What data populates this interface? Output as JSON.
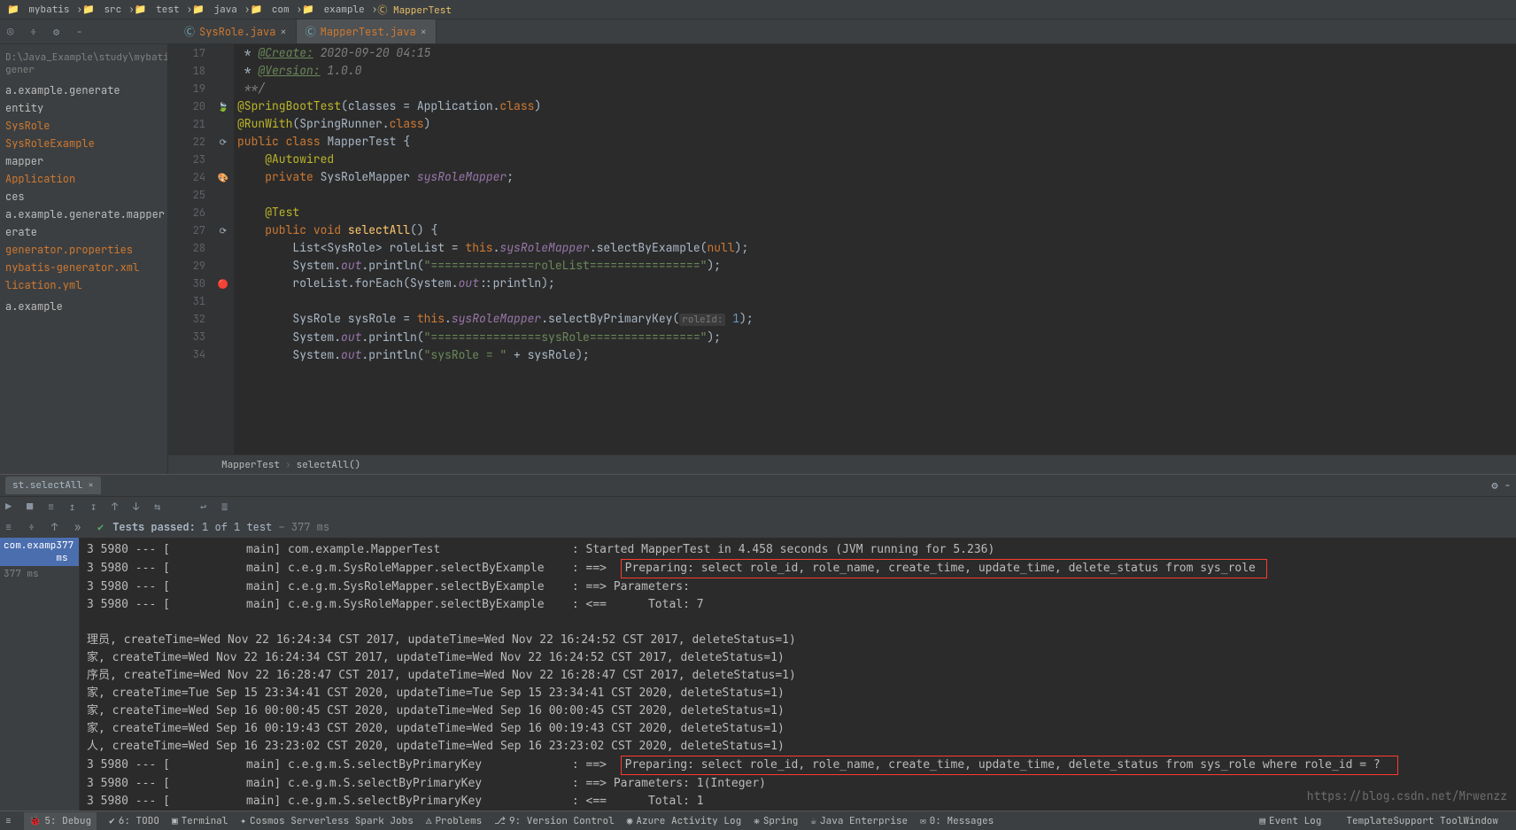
{
  "breadcrumb": [
    "mybatis",
    "src",
    "test",
    "java",
    "com",
    "example",
    "MapperTest"
  ],
  "projectPath": "D:\\Java_Example\\study\\mybatis-gener",
  "tabs": [
    {
      "name": "SysRole.java",
      "active": false
    },
    {
      "name": "MapperTest.java",
      "active": true
    }
  ],
  "tree": [
    {
      "label": "a.example.generate",
      "cls": "normal"
    },
    {
      "label": "entity",
      "cls": "normal"
    },
    {
      "label": "SysRole",
      "cls": "orange"
    },
    {
      "label": "SysRoleExample",
      "cls": "orange"
    },
    {
      "label": "mapper",
      "cls": "normal"
    },
    {
      "label": "Application",
      "cls": "orange"
    },
    {
      "label": "ces",
      "cls": "normal"
    },
    {
      "label": "a.example.generate.mapper",
      "cls": "normal"
    },
    {
      "label": "erate",
      "cls": "normal"
    },
    {
      "label": "generator.properties",
      "cls": "orange"
    },
    {
      "label": "nybatis-generator.xml",
      "cls": "orange"
    },
    {
      "label": "lication.yml",
      "cls": "orange"
    },
    {
      "label": "",
      "cls": "normal"
    },
    {
      "label": "a.example",
      "cls": "normal"
    }
  ],
  "code": {
    "lines": [
      {
        "n": 17,
        "html": "&nbsp;* <span class='doc-tag'>@Create:</span> <span class='comment'>2020-09-20 04:15</span>"
      },
      {
        "n": 18,
        "html": "&nbsp;* <span class='doc-tag'>@Version:</span> <span class='comment'>1.0.0</span>"
      },
      {
        "n": 19,
        "html": "&nbsp;<span class='comment'>**/</span>"
      },
      {
        "n": 20,
        "html": "<span class='anno'>@SpringBootTest</span>(classes = Application.<span class='kw'>class</span>)"
      },
      {
        "n": 21,
        "html": "<span class='anno'>@RunWith</span>(SpringRunner.<span class='kw'>class</span>)"
      },
      {
        "n": 22,
        "html": "<span class='kw'>public</span> <span class='kw'>class</span> MapperTest {"
      },
      {
        "n": 23,
        "html": "&nbsp;&nbsp;&nbsp;&nbsp;<span class='anno'>@Autowired</span>"
      },
      {
        "n": 24,
        "html": "&nbsp;&nbsp;&nbsp;&nbsp;<span class='kw'>private</span> SysRoleMapper <span class='field'>sysRoleMapper</span>;"
      },
      {
        "n": 25,
        "html": ""
      },
      {
        "n": 26,
        "html": "&nbsp;&nbsp;&nbsp;&nbsp;<span class='anno'>@Test</span>"
      },
      {
        "n": 27,
        "html": "&nbsp;&nbsp;&nbsp;&nbsp;<span class='kw'>public</span> <span class='kw'>void</span> <span class='method'>selectAll</span>() {"
      },
      {
        "n": 28,
        "html": "&nbsp;&nbsp;&nbsp;&nbsp;&nbsp;&nbsp;&nbsp;&nbsp;List&lt;SysRole&gt; roleList = <span class='kw'>this</span>.<span class='field'>sysRoleMapper</span>.selectByExample(<span class='kw'>null</span>);"
      },
      {
        "n": 29,
        "html": "&nbsp;&nbsp;&nbsp;&nbsp;&nbsp;&nbsp;&nbsp;&nbsp;System.<span class='field'>out</span>.println(<span class='str'>\"===============roleList================\"</span>);"
      },
      {
        "n": 30,
        "html": "&nbsp;&nbsp;&nbsp;&nbsp;&nbsp;&nbsp;&nbsp;&nbsp;roleList.forEach(System.<span class='field'>out</span>::println);"
      },
      {
        "n": 31,
        "html": ""
      },
      {
        "n": 32,
        "html": "&nbsp;&nbsp;&nbsp;&nbsp;&nbsp;&nbsp;&nbsp;&nbsp;SysRole sysRole = <span class='kw'>this</span>.<span class='field'>sysRoleMapper</span>.selectByPrimaryKey(<span class='param-hint'>roleId:</span> <span class='num'>1</span>);"
      },
      {
        "n": 33,
        "html": "&nbsp;&nbsp;&nbsp;&nbsp;&nbsp;&nbsp;&nbsp;&nbsp;System.<span class='field'>out</span>.println(<span class='str'>\"================sysRole================\"</span>);"
      },
      {
        "n": 34,
        "html": "&nbsp;&nbsp;&nbsp;&nbsp;&nbsp;&nbsp;&nbsp;&nbsp;System.<span class='field'>out</span>.println(<span class='str'>\"sysRole = \"</span> + sysRole);"
      }
    ]
  },
  "navBreadcrumb": [
    "MapperTest",
    "selectAll()"
  ],
  "debugTab": "st.selectAll",
  "testStatus": {
    "label": "Tests passed:",
    "count": "1",
    "of": "of 1 test",
    "time": "– 377 ms"
  },
  "testTree": {
    "item": "com.examp",
    "itemTime": "377 ms",
    "subTime": "377 ms"
  },
  "console": [
    "3 5980 --- [           main] com.example.MapperTest                   : Started MapperTest in 4.458 seconds (JVM running for 5.236)",
    {
      "prefix": "3 5980 --- [           main] c.e.g.m.SysRoleMapper.selectByExample    : ==>  ",
      "hl": "Preparing: select role_id, role_name, create_time, update_time, delete_status from sys_role "
    },
    "3 5980 --- [           main] c.e.g.m.SysRoleMapper.selectByExample    : ==> Parameters: ",
    "3 5980 --- [           main] c.e.g.m.SysRoleMapper.selectByExample    : <==      Total: 7",
    "",
    "理员, createTime=Wed Nov 22 16:24:34 CST 2017, updateTime=Wed Nov 22 16:24:52 CST 2017, deleteStatus=1)",
    "家, createTime=Wed Nov 22 16:24:34 CST 2017, updateTime=Wed Nov 22 16:24:52 CST 2017, deleteStatus=1)",
    "序员, createTime=Wed Nov 22 16:28:47 CST 2017, updateTime=Wed Nov 22 16:28:47 CST 2017, deleteStatus=1)",
    "家, createTime=Tue Sep 15 23:34:41 CST 2020, updateTime=Tue Sep 15 23:34:41 CST 2020, deleteStatus=1)",
    "家, createTime=Wed Sep 16 00:00:45 CST 2020, updateTime=Wed Sep 16 00:00:45 CST 2020, deleteStatus=1)",
    "家, createTime=Wed Sep 16 00:19:43 CST 2020, updateTime=Wed Sep 16 00:19:43 CST 2020, deleteStatus=1)",
    "人, createTime=Wed Sep 16 23:23:02 CST 2020, updateTime=Wed Sep 16 23:23:02 CST 2020, deleteStatus=1)",
    {
      "prefix": "3 5980 --- [           main] c.e.g.m.S.selectByPrimaryKey             : ==>  ",
      "hl": "Preparing: select role_id, role_name, create_time, update_time, delete_status from sys_role where role_id = ?  "
    },
    "3 5980 --- [           main] c.e.g.m.S.selectByPrimaryKey             : ==> Parameters: 1(Integer)",
    "3 5980 --- [           main] c.e.g.m.S.selectByPrimaryKey             : <==      Total: 1"
  ],
  "statusBar": {
    "left": [
      "5: Debug",
      "6: TODO",
      "Terminal",
      "Cosmos Serverless Spark Jobs",
      "Problems",
      "9: Version Control",
      "Azure Activity Log",
      "Spring",
      "Java Enterprise",
      "0: Messages"
    ],
    "right": [
      "Event Log",
      "TemplateSupport ToolWindow"
    ]
  },
  "watermark": "https://blog.csdn.net/Mrwenzz"
}
